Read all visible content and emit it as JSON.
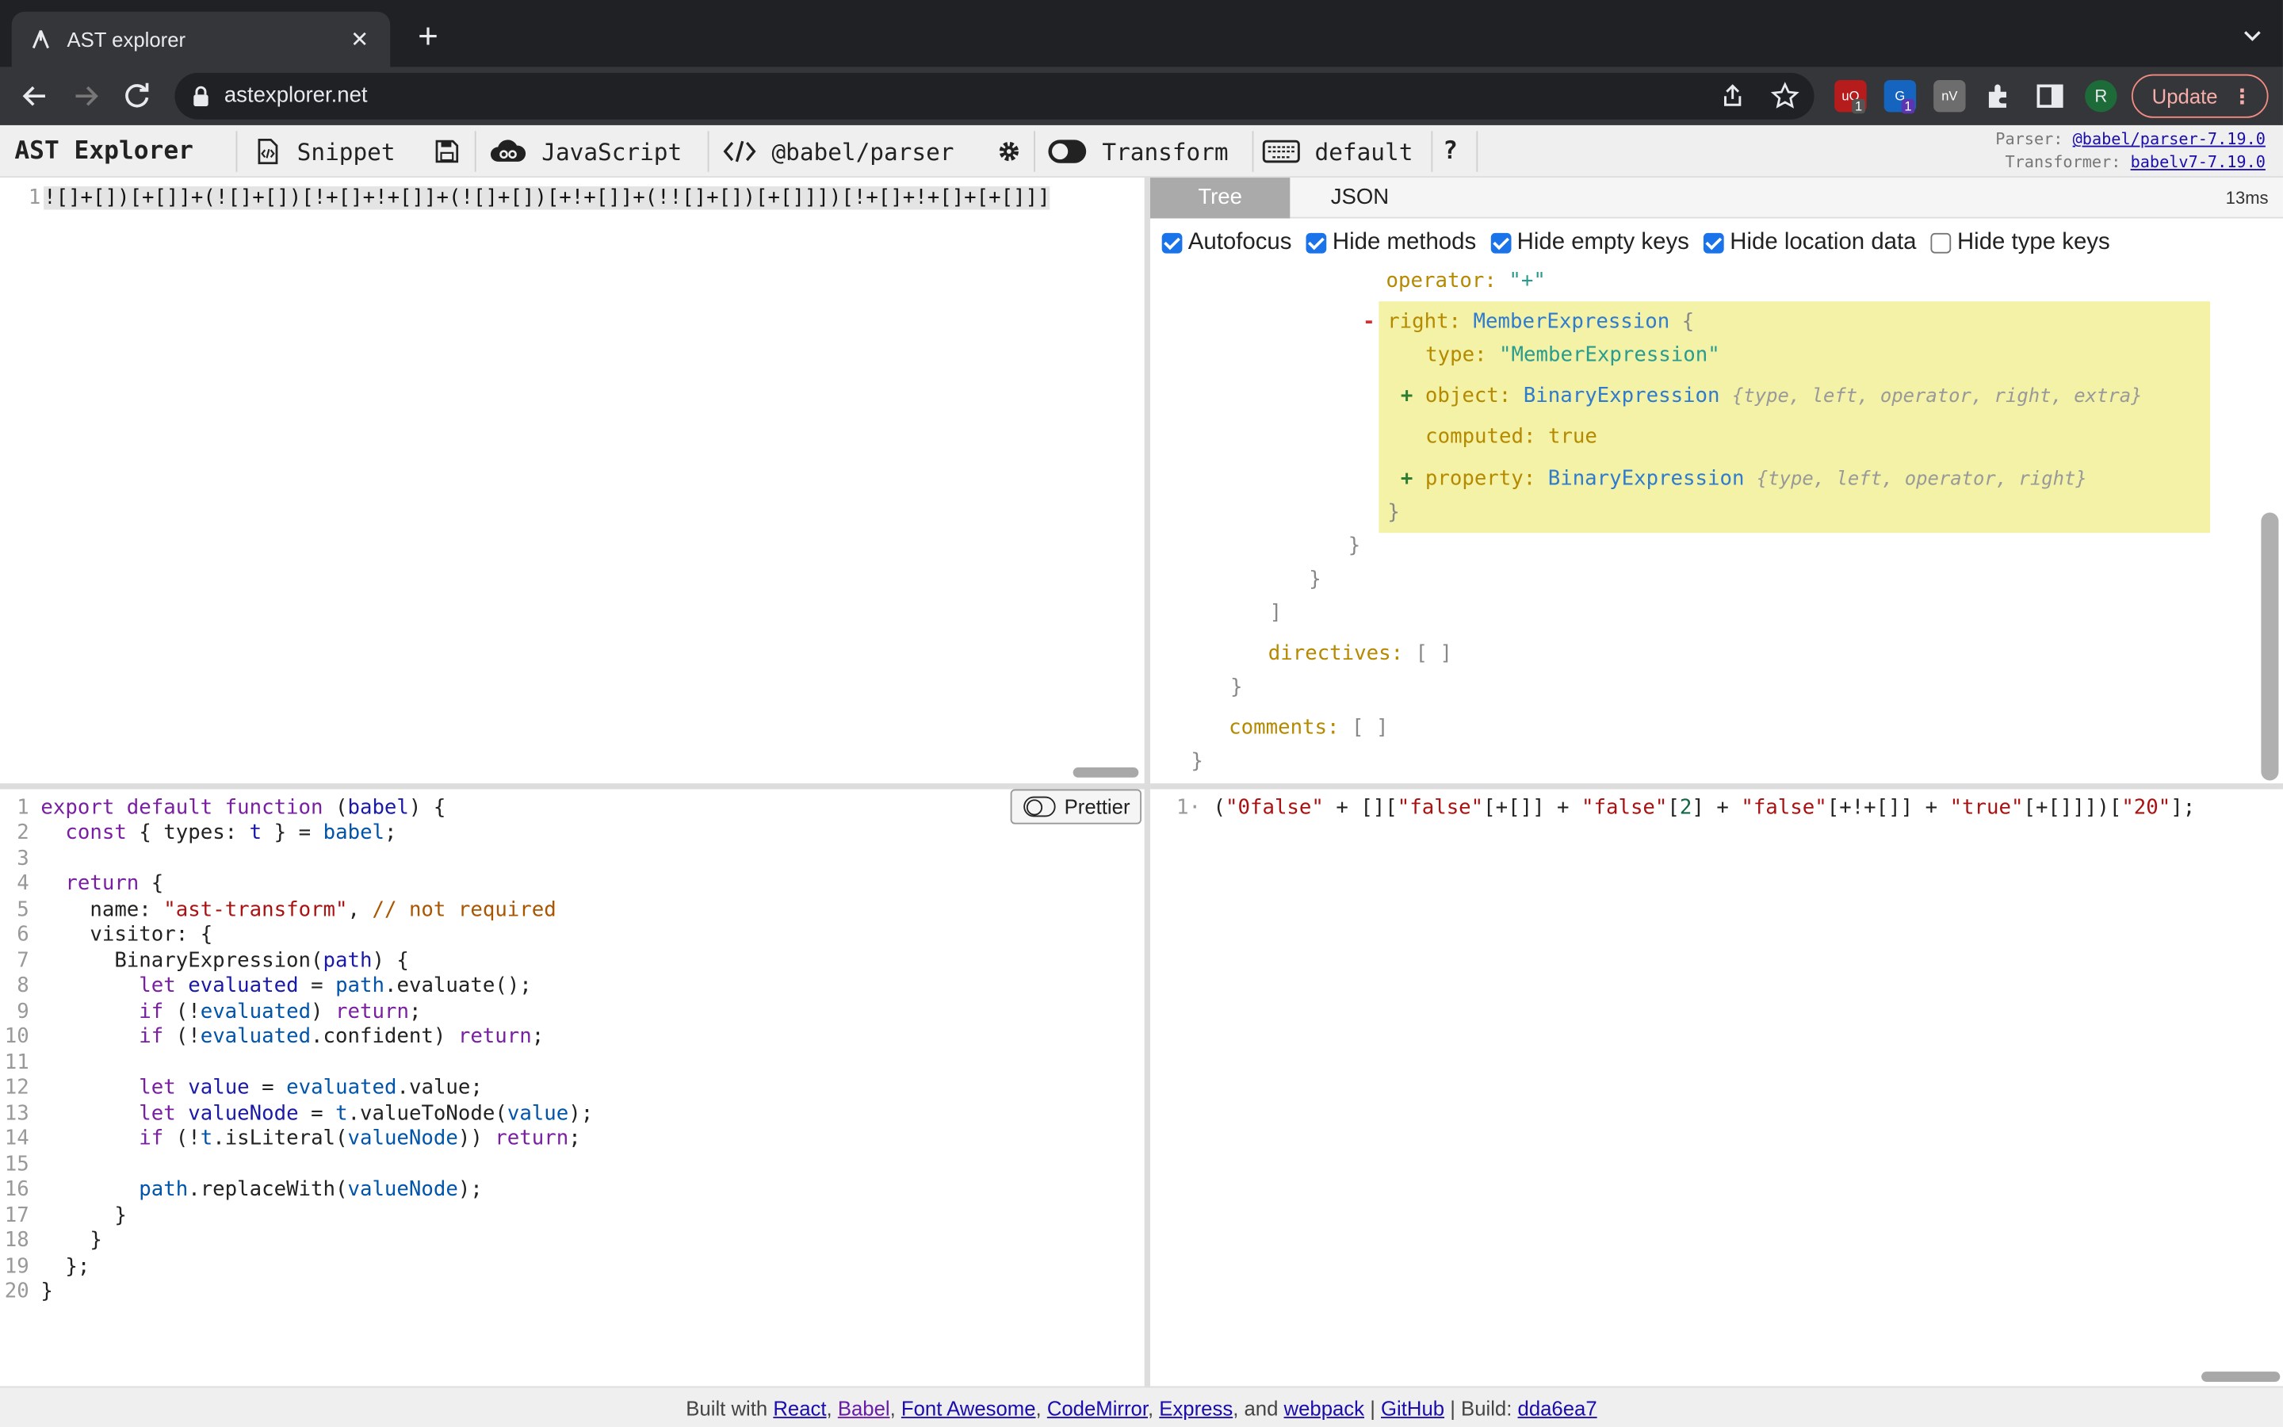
{
  "browser": {
    "tab_title": "AST explorer",
    "tab_close": "✕",
    "new_tab": "+",
    "url": "astexplorer.net",
    "ext_badge_1": "1",
    "ext_badge_2": "1",
    "avatar_letter": "R",
    "update_label": "Update"
  },
  "toolbar": {
    "brand": "AST Explorer",
    "snippet": "Snippet",
    "language": "JavaScript",
    "parser": "@babel/parser",
    "transform": "Transform",
    "keymap": "default",
    "help": "?",
    "parser_label": "Parser:",
    "parser_version": "@babel/parser-7.19.0",
    "transformer_label": "Transformer:",
    "transformer_version": "babelv7-7.19.0"
  },
  "source": {
    "line_no": "1",
    "code": "![]+[])[+[]]+(![]+[])[!+[]+!+[]]+(![]+[])[+!+[]]+(!![]+[])[+[]]])[!+[]+!+[]+[+[]]]"
  },
  "tree_panel": {
    "tabs": [
      "Tree",
      "JSON"
    ],
    "timing": "13ms",
    "options": [
      {
        "label": "Autofocus",
        "checked": true
      },
      {
        "label": "Hide methods",
        "checked": true
      },
      {
        "label": "Hide empty keys",
        "checked": true
      },
      {
        "label": "Hide location data",
        "checked": true
      },
      {
        "label": "Hide type keys",
        "checked": false
      }
    ],
    "nodes": {
      "operator_key": "operator:",
      "operator_val": "\"+\"",
      "right_key": "right:",
      "right_type": "MemberExpression",
      "type_key": "type:",
      "type_val": "\"MemberExpression\"",
      "object_key": "object:",
      "object_type": "BinaryExpression",
      "object_summary": "{type, left, operator, right, extra}",
      "computed_key": "computed:",
      "computed_val": "true",
      "property_key": "property:",
      "property_type": "BinaryExpression",
      "property_summary": "{type, left, operator, right}",
      "directives_key": "directives:",
      "directives_val": "[ ]",
      "comments_key": "comments:",
      "comments_val": "[ ]",
      "open_brace": "{",
      "close_brace": "}",
      "close_bracket": "]",
      "minus": "-",
      "plus": "+"
    }
  },
  "transform_code": {
    "prettier_label": "Prettier",
    "line_numbers": [
      "1",
      "2",
      "3",
      "4",
      "5",
      "6",
      "7",
      "8",
      "9",
      "10",
      "11",
      "12",
      "13",
      "14",
      "15",
      "16",
      "17",
      "18",
      "19",
      "20"
    ],
    "l1_kw": "export default function",
    "l1_param": "babel",
    "l2_kw": "const",
    "l2_a": "{ types:",
    "l2_t": "t",
    "l2_b": "} =",
    "l2_babel": "babel",
    "l2_end": ";",
    "l4_kw": "return",
    "l4_end": "{",
    "l5_key": "name:",
    "l5_str": "\"ast-transform\"",
    "l5_comma": ",",
    "l5_cm": "// not required",
    "l6": "visitor: {",
    "l7_fn": "BinaryExpression(",
    "l7_param": "path",
    "l7_end": ") {",
    "l8_kw": "let",
    "l8_var": "evaluated",
    "l8_eq": "=",
    "l8_path": "path",
    "l8_rest": ".evaluate();",
    "l9_kw": "if",
    "l9_a": "(!",
    "l9_var": "evaluated",
    "l9_b": ")",
    "l9_ret": "return",
    "l9_end": ";",
    "l10_kw": "if",
    "l10_a": "(!",
    "l10_var": "evaluated",
    "l10_b": ".confident)",
    "l10_ret": "return",
    "l10_end": ";",
    "l12_kw": "let",
    "l12_var": "value",
    "l12_eq": "=",
    "l12_ev": "evaluated",
    "l12_rest": ".value;",
    "l13_kw": "let",
    "l13_var": "valueNode",
    "l13_eq": "=",
    "l13_t": "t",
    "l13_fn": ".valueToNode(",
    "l13_arg": "value",
    "l13_end": ");",
    "l14_kw": "if",
    "l14_a": "(!",
    "l14_t": "t",
    "l14_fn": ".isLiteral(",
    "l14_arg": "valueNode",
    "l14_b": "))",
    "l14_ret": "return",
    "l14_end": ";",
    "l16_path": "path",
    "l16_fn": ".replaceWith(",
    "l16_arg": "valueNode",
    "l16_end": ");",
    "l17": "}",
    "l18": "}",
    "l19": "};",
    "l20": "}"
  },
  "output": {
    "line_no": "1·",
    "p1": "(",
    "s1": "\"0false\"",
    "p2": " + [][",
    "s2": "\"false\"",
    "p3": "[+[]] + ",
    "s3": "\"false\"",
    "p4": "[",
    "n1": "2",
    "p5": "] + ",
    "s4": "\"false\"",
    "p6": "[+!+[]] + ",
    "s5": "\"true\"",
    "p7": "[+[]]])[",
    "s6": "\"20\"",
    "p8": "];"
  },
  "footer": {
    "built_with": "Built with",
    "react": "React",
    "babel": "Babel",
    "fontawesome": "Font Awesome",
    "codemirror": "CodeMirror",
    "express": "Express",
    "and": "and",
    "webpack": "webpack",
    "sep": "|",
    "github": "GitHub",
    "build_label": "Build:",
    "build": "dda6ea7"
  },
  "colors": {
    "chrome_dark": "#202124",
    "chrome_tab": "#35363a",
    "toolbar_bg": "#efefef",
    "highlight": "#f3f2a6",
    "accent": "#1a73e8"
  }
}
